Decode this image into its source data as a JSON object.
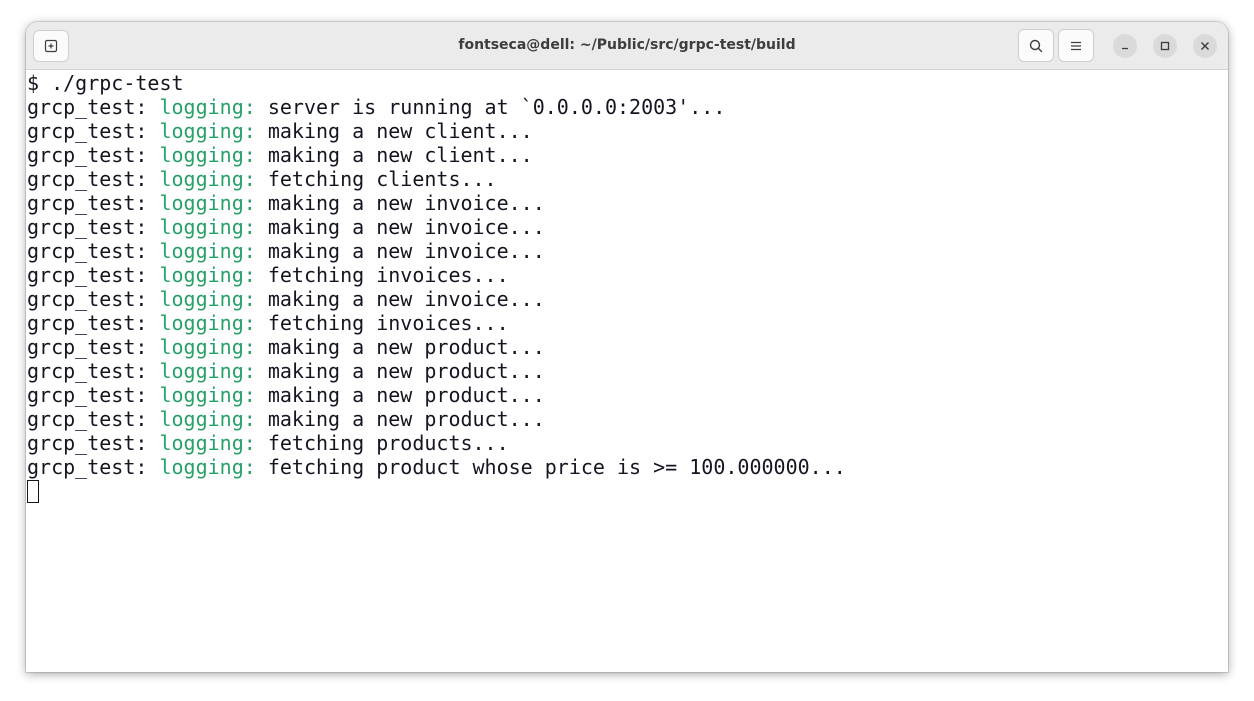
{
  "window": {
    "title": "fontseca@dell: ~/Public/src/grpc-test/build"
  },
  "titlebar_buttons": {
    "new_tab_icon": "new-tab-icon",
    "search_icon": "search-icon",
    "menu_icon": "hamburger-menu-icon",
    "minimize_icon": "minimize-icon",
    "maximize_icon": "maximize-icon",
    "close_icon": "close-icon"
  },
  "colors": {
    "log_tag": "#26a269",
    "text": "#171421",
    "titlebar": "#ebebeb"
  },
  "terminal": {
    "command": "$ ./grpc-test",
    "lines": [
      {
        "prefix": "grcp_test: ",
        "tag": "logging:",
        "message": " server is running at `0.0.0.0:2003'..."
      },
      {
        "prefix": "grcp_test: ",
        "tag": "logging:",
        "message": " making a new client..."
      },
      {
        "prefix": "grcp_test: ",
        "tag": "logging:",
        "message": " making a new client..."
      },
      {
        "prefix": "grcp_test: ",
        "tag": "logging:",
        "message": " fetching clients..."
      },
      {
        "prefix": "grcp_test: ",
        "tag": "logging:",
        "message": " making a new invoice..."
      },
      {
        "prefix": "grcp_test: ",
        "tag": "logging:",
        "message": " making a new invoice..."
      },
      {
        "prefix": "grcp_test: ",
        "tag": "logging:",
        "message": " making a new invoice..."
      },
      {
        "prefix": "grcp_test: ",
        "tag": "logging:",
        "message": " fetching invoices..."
      },
      {
        "prefix": "grcp_test: ",
        "tag": "logging:",
        "message": " making a new invoice..."
      },
      {
        "prefix": "grcp_test: ",
        "tag": "logging:",
        "message": " fetching invoices..."
      },
      {
        "prefix": "grcp_test: ",
        "tag": "logging:",
        "message": " making a new product..."
      },
      {
        "prefix": "grcp_test: ",
        "tag": "logging:",
        "message": " making a new product..."
      },
      {
        "prefix": "grcp_test: ",
        "tag": "logging:",
        "message": " making a new product..."
      },
      {
        "prefix": "grcp_test: ",
        "tag": "logging:",
        "message": " making a new product..."
      },
      {
        "prefix": "grcp_test: ",
        "tag": "logging:",
        "message": " fetching products..."
      },
      {
        "prefix": "grcp_test: ",
        "tag": "logging:",
        "message": " fetching product whose price is >= 100.000000..."
      }
    ]
  }
}
